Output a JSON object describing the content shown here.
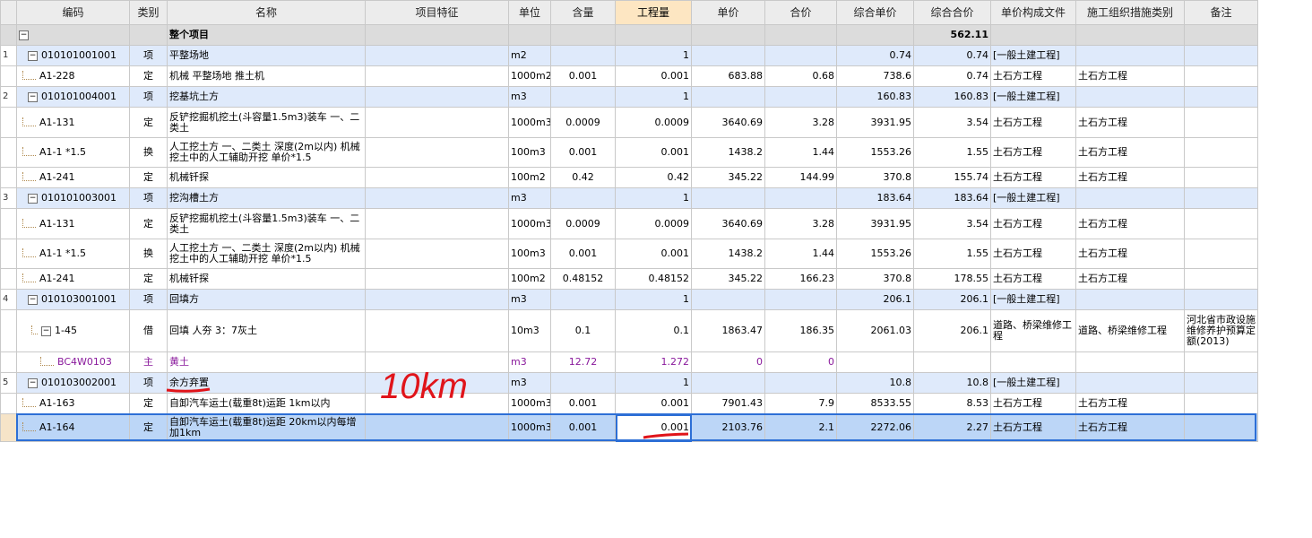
{
  "header": {
    "rownum": "",
    "code": "编码",
    "type": "类别",
    "name": "名称",
    "feature": "项目特征",
    "unit": "单位",
    "content": "含量",
    "quantity": "工程量",
    "price": "单价",
    "total": "合价",
    "unit_price_all": "综合单价",
    "total_all": "综合合价",
    "price_file": "单价构成文件",
    "measure_type": "施工组织措施类别",
    "remark": "备注"
  },
  "root": {
    "toggle": "−",
    "name": "整个项目",
    "total_all": "562.11"
  },
  "rows": [
    {
      "rn": "1",
      "code": "010101001001",
      "type": "项",
      "name": "平整场地",
      "unit": "m2",
      "content": "",
      "qty": "1",
      "price": "",
      "total": "",
      "uprice": "0.74",
      "tall": "0.74",
      "file": "[一般土建工程]",
      "measure": "",
      "remark": ""
    },
    {
      "rn": "",
      "code": "A1-228",
      "type": "定",
      "name": "机械 平整场地 推土机",
      "unit": "1000m2",
      "content": "0.001",
      "qty": "0.001",
      "price": "683.88",
      "total": "0.68",
      "uprice": "738.6",
      "tall": "0.74",
      "file": "土石方工程",
      "measure": "土石方工程",
      "remark": ""
    },
    {
      "rn": "2",
      "code": "010101004001",
      "type": "项",
      "name": "挖基坑土方",
      "unit": "m3",
      "content": "",
      "qty": "1",
      "price": "",
      "total": "",
      "uprice": "160.83",
      "tall": "160.83",
      "file": "[一般土建工程]",
      "measure": "",
      "remark": ""
    },
    {
      "rn": "",
      "code": "A1-131",
      "type": "定",
      "name": "反铲挖掘机挖土(斗容量1.5m3)装车 一、二类土",
      "unit": "1000m3",
      "content": "0.0009",
      "qty": "0.0009",
      "price": "3640.69",
      "total": "3.28",
      "uprice": "3931.95",
      "tall": "3.54",
      "file": "土石方工程",
      "measure": "土石方工程",
      "remark": ""
    },
    {
      "rn": "",
      "code": "A1-1 *1.5",
      "type": "换",
      "name": "人工挖土方 一、二类土 深度(2m以内) 机械挖土中的人工辅助开挖 单价*1.5",
      "unit": "100m3",
      "content": "0.001",
      "qty": "0.001",
      "price": "1438.2",
      "total": "1.44",
      "uprice": "1553.26",
      "tall": "1.55",
      "file": "土石方工程",
      "measure": "土石方工程",
      "remark": ""
    },
    {
      "rn": "",
      "code": "A1-241",
      "type": "定",
      "name": "机械钎探",
      "unit": "100m2",
      "content": "0.42",
      "qty": "0.42",
      "price": "345.22",
      "total": "144.99",
      "uprice": "370.8",
      "tall": "155.74",
      "file": "土石方工程",
      "measure": "土石方工程",
      "remark": ""
    },
    {
      "rn": "3",
      "code": "010101003001",
      "type": "项",
      "name": "挖沟槽土方",
      "unit": "m3",
      "content": "",
      "qty": "1",
      "price": "",
      "total": "",
      "uprice": "183.64",
      "tall": "183.64",
      "file": "[一般土建工程]",
      "measure": "",
      "remark": ""
    },
    {
      "rn": "",
      "code": "A1-131",
      "type": "定",
      "name": "反铲挖掘机挖土(斗容量1.5m3)装车 一、二类土",
      "unit": "1000m3",
      "content": "0.0009",
      "qty": "0.0009",
      "price": "3640.69",
      "total": "3.28",
      "uprice": "3931.95",
      "tall": "3.54",
      "file": "土石方工程",
      "measure": "土石方工程",
      "remark": ""
    },
    {
      "rn": "",
      "code": "A1-1 *1.5",
      "type": "换",
      "name": "人工挖土方 一、二类土 深度(2m以内) 机械挖土中的人工辅助开挖 单价*1.5",
      "unit": "100m3",
      "content": "0.001",
      "qty": "0.001",
      "price": "1438.2",
      "total": "1.44",
      "uprice": "1553.26",
      "tall": "1.55",
      "file": "土石方工程",
      "measure": "土石方工程",
      "remark": ""
    },
    {
      "rn": "",
      "code": "A1-241",
      "type": "定",
      "name": "机械钎探",
      "unit": "100m2",
      "content": "0.48152",
      "qty": "0.48152",
      "price": "345.22",
      "total": "166.23",
      "uprice": "370.8",
      "tall": "178.55",
      "file": "土石方工程",
      "measure": "土石方工程",
      "remark": ""
    },
    {
      "rn": "4",
      "code": "010103001001",
      "type": "项",
      "name": "回填方",
      "unit": "m3",
      "content": "",
      "qty": "1",
      "price": "",
      "total": "",
      "uprice": "206.1",
      "tall": "206.1",
      "file": "[一般土建工程]",
      "measure": "",
      "remark": ""
    },
    {
      "rn": "",
      "code": "1-45",
      "type": "借",
      "name": "回填 人夯 3：7灰土",
      "unit": "10m3",
      "content": "0.1",
      "qty": "0.1",
      "price": "1863.47",
      "total": "186.35",
      "uprice": "2061.03",
      "tall": "206.1",
      "file": "道路、桥梁维修工程",
      "measure": "道路、桥梁维修工程",
      "remark": "河北省市政设施维修养护预算定额(2013)"
    },
    {
      "rn": "",
      "code": "BC4W0103",
      "type": "主",
      "name": "黄土",
      "unit": "m3",
      "content": "12.72",
      "qty": "1.272",
      "price": "0",
      "total": "0",
      "uprice": "",
      "tall": "",
      "file": "",
      "measure": "",
      "remark": ""
    },
    {
      "rn": "5",
      "code": "010103002001",
      "type": "项",
      "name": "余方弃置",
      "unit": "m3",
      "content": "",
      "qty": "1",
      "price": "",
      "total": "",
      "uprice": "10.8",
      "tall": "10.8",
      "file": "[一般土建工程]",
      "measure": "",
      "remark": ""
    },
    {
      "rn": "",
      "code": "A1-163",
      "type": "定",
      "name": "自卸汽车运土(载重8t)运距 1km以内",
      "unit": "1000m3",
      "content": "0.001",
      "qty": "0.001",
      "price": "7901.43",
      "total": "7.9",
      "uprice": "8533.55",
      "tall": "8.53",
      "file": "土石方工程",
      "measure": "土石方工程",
      "remark": ""
    },
    {
      "rn": "",
      "code": "A1-164",
      "type": "定",
      "name": "自卸汽车运土(载重8t)运距 20km以内每增加1km",
      "unit": "1000m3",
      "content": "0.001",
      "qty": "0.001",
      "price": "2103.76",
      "total": "2.1",
      "uprice": "2272.06",
      "tall": "2.27",
      "file": "土石方工程",
      "measure": "土石方工程",
      "remark": ""
    }
  ],
  "annotation": {
    "handwritten": "10km",
    "color": "#e0141a"
  },
  "colors": {
    "header_bg": "#ececec",
    "active_header": "#fde6c2",
    "qd_row": "#dfeafb",
    "selected_row": "#bcd6f7",
    "material_text": "#8a1a9c",
    "selection_border": "#2d6fd6"
  }
}
